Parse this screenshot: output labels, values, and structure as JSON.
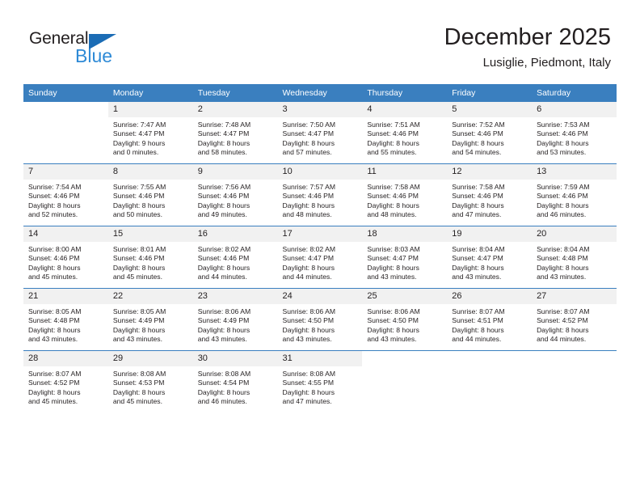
{
  "logo": {
    "text_primary": "General",
    "text_secondary": "Blue",
    "triangle_icon": "triangle-icon",
    "color_primary": "#231f20",
    "color_secondary": "#2e8ad6",
    "color_triangle": "#1b6cb5"
  },
  "header": {
    "title": "December 2025",
    "subtitle": "Lusiglie, Piedmont, Italy"
  },
  "theme": {
    "header_bg": "#3a7fbf",
    "header_text": "#ffffff",
    "daynum_bg": "#f1f1f1",
    "body_text": "#231f20"
  },
  "columns": [
    "Sunday",
    "Monday",
    "Tuesday",
    "Wednesday",
    "Thursday",
    "Friday",
    "Saturday"
  ],
  "weeks": [
    [
      {
        "day": "",
        "sunrise": "",
        "sunset": "",
        "daylight1": "",
        "daylight2": ""
      },
      {
        "day": "1",
        "sunrise": "Sunrise: 7:47 AM",
        "sunset": "Sunset: 4:47 PM",
        "daylight1": "Daylight: 9 hours",
        "daylight2": "and 0 minutes."
      },
      {
        "day": "2",
        "sunrise": "Sunrise: 7:48 AM",
        "sunset": "Sunset: 4:47 PM",
        "daylight1": "Daylight: 8 hours",
        "daylight2": "and 58 minutes."
      },
      {
        "day": "3",
        "sunrise": "Sunrise: 7:50 AM",
        "sunset": "Sunset: 4:47 PM",
        "daylight1": "Daylight: 8 hours",
        "daylight2": "and 57 minutes."
      },
      {
        "day": "4",
        "sunrise": "Sunrise: 7:51 AM",
        "sunset": "Sunset: 4:46 PM",
        "daylight1": "Daylight: 8 hours",
        "daylight2": "and 55 minutes."
      },
      {
        "day": "5",
        "sunrise": "Sunrise: 7:52 AM",
        "sunset": "Sunset: 4:46 PM",
        "daylight1": "Daylight: 8 hours",
        "daylight2": "and 54 minutes."
      },
      {
        "day": "6",
        "sunrise": "Sunrise: 7:53 AM",
        "sunset": "Sunset: 4:46 PM",
        "daylight1": "Daylight: 8 hours",
        "daylight2": "and 53 minutes."
      }
    ],
    [
      {
        "day": "7",
        "sunrise": "Sunrise: 7:54 AM",
        "sunset": "Sunset: 4:46 PM",
        "daylight1": "Daylight: 8 hours",
        "daylight2": "and 52 minutes."
      },
      {
        "day": "8",
        "sunrise": "Sunrise: 7:55 AM",
        "sunset": "Sunset: 4:46 PM",
        "daylight1": "Daylight: 8 hours",
        "daylight2": "and 50 minutes."
      },
      {
        "day": "9",
        "sunrise": "Sunrise: 7:56 AM",
        "sunset": "Sunset: 4:46 PM",
        "daylight1": "Daylight: 8 hours",
        "daylight2": "and 49 minutes."
      },
      {
        "day": "10",
        "sunrise": "Sunrise: 7:57 AM",
        "sunset": "Sunset: 4:46 PM",
        "daylight1": "Daylight: 8 hours",
        "daylight2": "and 48 minutes."
      },
      {
        "day": "11",
        "sunrise": "Sunrise: 7:58 AM",
        "sunset": "Sunset: 4:46 PM",
        "daylight1": "Daylight: 8 hours",
        "daylight2": "and 48 minutes."
      },
      {
        "day": "12",
        "sunrise": "Sunrise: 7:58 AM",
        "sunset": "Sunset: 4:46 PM",
        "daylight1": "Daylight: 8 hours",
        "daylight2": "and 47 minutes."
      },
      {
        "day": "13",
        "sunrise": "Sunrise: 7:59 AM",
        "sunset": "Sunset: 4:46 PM",
        "daylight1": "Daylight: 8 hours",
        "daylight2": "and 46 minutes."
      }
    ],
    [
      {
        "day": "14",
        "sunrise": "Sunrise: 8:00 AM",
        "sunset": "Sunset: 4:46 PM",
        "daylight1": "Daylight: 8 hours",
        "daylight2": "and 45 minutes."
      },
      {
        "day": "15",
        "sunrise": "Sunrise: 8:01 AM",
        "sunset": "Sunset: 4:46 PM",
        "daylight1": "Daylight: 8 hours",
        "daylight2": "and 45 minutes."
      },
      {
        "day": "16",
        "sunrise": "Sunrise: 8:02 AM",
        "sunset": "Sunset: 4:46 PM",
        "daylight1": "Daylight: 8 hours",
        "daylight2": "and 44 minutes."
      },
      {
        "day": "17",
        "sunrise": "Sunrise: 8:02 AM",
        "sunset": "Sunset: 4:47 PM",
        "daylight1": "Daylight: 8 hours",
        "daylight2": "and 44 minutes."
      },
      {
        "day": "18",
        "sunrise": "Sunrise: 8:03 AM",
        "sunset": "Sunset: 4:47 PM",
        "daylight1": "Daylight: 8 hours",
        "daylight2": "and 43 minutes."
      },
      {
        "day": "19",
        "sunrise": "Sunrise: 8:04 AM",
        "sunset": "Sunset: 4:47 PM",
        "daylight1": "Daylight: 8 hours",
        "daylight2": "and 43 minutes."
      },
      {
        "day": "20",
        "sunrise": "Sunrise: 8:04 AM",
        "sunset": "Sunset: 4:48 PM",
        "daylight1": "Daylight: 8 hours",
        "daylight2": "and 43 minutes."
      }
    ],
    [
      {
        "day": "21",
        "sunrise": "Sunrise: 8:05 AM",
        "sunset": "Sunset: 4:48 PM",
        "daylight1": "Daylight: 8 hours",
        "daylight2": "and 43 minutes."
      },
      {
        "day": "22",
        "sunrise": "Sunrise: 8:05 AM",
        "sunset": "Sunset: 4:49 PM",
        "daylight1": "Daylight: 8 hours",
        "daylight2": "and 43 minutes."
      },
      {
        "day": "23",
        "sunrise": "Sunrise: 8:06 AM",
        "sunset": "Sunset: 4:49 PM",
        "daylight1": "Daylight: 8 hours",
        "daylight2": "and 43 minutes."
      },
      {
        "day": "24",
        "sunrise": "Sunrise: 8:06 AM",
        "sunset": "Sunset: 4:50 PM",
        "daylight1": "Daylight: 8 hours",
        "daylight2": "and 43 minutes."
      },
      {
        "day": "25",
        "sunrise": "Sunrise: 8:06 AM",
        "sunset": "Sunset: 4:50 PM",
        "daylight1": "Daylight: 8 hours",
        "daylight2": "and 43 minutes."
      },
      {
        "day": "26",
        "sunrise": "Sunrise: 8:07 AM",
        "sunset": "Sunset: 4:51 PM",
        "daylight1": "Daylight: 8 hours",
        "daylight2": "and 44 minutes."
      },
      {
        "day": "27",
        "sunrise": "Sunrise: 8:07 AM",
        "sunset": "Sunset: 4:52 PM",
        "daylight1": "Daylight: 8 hours",
        "daylight2": "and 44 minutes."
      }
    ],
    [
      {
        "day": "28",
        "sunrise": "Sunrise: 8:07 AM",
        "sunset": "Sunset: 4:52 PM",
        "daylight1": "Daylight: 8 hours",
        "daylight2": "and 45 minutes."
      },
      {
        "day": "29",
        "sunrise": "Sunrise: 8:08 AM",
        "sunset": "Sunset: 4:53 PM",
        "daylight1": "Daylight: 8 hours",
        "daylight2": "and 45 minutes."
      },
      {
        "day": "30",
        "sunrise": "Sunrise: 8:08 AM",
        "sunset": "Sunset: 4:54 PM",
        "daylight1": "Daylight: 8 hours",
        "daylight2": "and 46 minutes."
      },
      {
        "day": "31",
        "sunrise": "Sunrise: 8:08 AM",
        "sunset": "Sunset: 4:55 PM",
        "daylight1": "Daylight: 8 hours",
        "daylight2": "and 47 minutes."
      },
      {
        "day": "",
        "sunrise": "",
        "sunset": "",
        "daylight1": "",
        "daylight2": ""
      },
      {
        "day": "",
        "sunrise": "",
        "sunset": "",
        "daylight1": "",
        "daylight2": ""
      },
      {
        "day": "",
        "sunrise": "",
        "sunset": "",
        "daylight1": "",
        "daylight2": ""
      }
    ]
  ]
}
